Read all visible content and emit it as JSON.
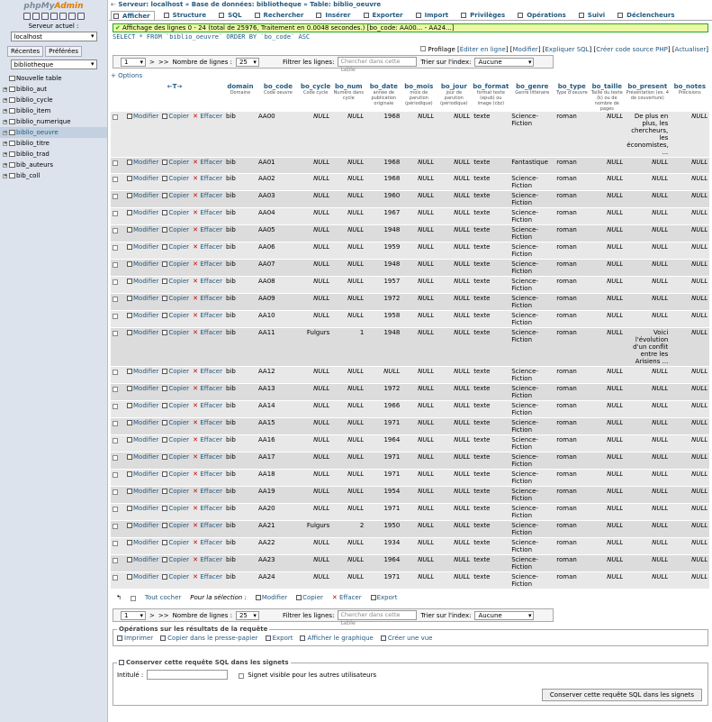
{
  "sidebar": {
    "logo_php": "php",
    "logo_my": "My",
    "logo_admin": "Admin",
    "server_label": "Serveur actuel :",
    "server_value": "localhost",
    "tabs": [
      "Récentes",
      "Préférées"
    ],
    "db_value": "bibliotheque",
    "tree": [
      {
        "label": "Nouvelle table",
        "active": false
      },
      {
        "label": "biblio_aut",
        "active": false
      },
      {
        "label": "biblio_cycle",
        "active": false
      },
      {
        "label": "biblio_item",
        "active": false
      },
      {
        "label": "biblio_numerique",
        "active": false
      },
      {
        "label": "biblio_oeuvre",
        "active": true
      },
      {
        "label": "biblio_titre",
        "active": false
      },
      {
        "label": "biblio_trad",
        "active": false
      },
      {
        "label": "bib_auteurs",
        "active": false
      },
      {
        "label": "bib_coll",
        "active": false
      }
    ]
  },
  "breadcrumb": {
    "server": "Serveur: localhost",
    "db": "Base de données: bibliotheque",
    "table": "Table: biblio_oeuvre"
  },
  "tabs": [
    "Afficher",
    "Structure",
    "SQL",
    "Rechercher",
    "Insérer",
    "Exporter",
    "Import",
    "Privilèges",
    "Opérations",
    "Suivi",
    "Déclencheurs"
  ],
  "message": "Affichage des lignes 0 - 24 (total de 25976, Traitement en 0.0048 secondes.) [bo_code: AA00... - AA24...]",
  "sql": "SELECT * FROM `biblio_oeuvre` ORDER BY `bo_code` ASC",
  "profiling": {
    "label": "Profilage",
    "links": [
      "Éditer en ligne",
      "Modifier",
      "Expliquer SQL",
      "Créer code source PHP",
      "Actualiser"
    ]
  },
  "nav": {
    "page": "1",
    "next": ">",
    "last": ">>",
    "rows_label": "Nombre de lignes :",
    "rows_value": "25",
    "filter_label": "Filtrer les lignes:",
    "filter_placeholder": "Chercher dans cette table",
    "sort_label": "Trier sur l'index:",
    "sort_value": "Aucune"
  },
  "options_link": "+ Options",
  "columns": [
    {
      "name": "domain",
      "sub": "Domaine"
    },
    {
      "name": "bo_code",
      "sub": "Code oeuvre"
    },
    {
      "name": "bo_cycle",
      "sub": "Code cycle"
    },
    {
      "name": "bo_num",
      "sub": "Numéro dans cycle"
    },
    {
      "name": "bo_date",
      "sub": "année de publication originale"
    },
    {
      "name": "bo_mois",
      "sub": "mois de parution (périodique)"
    },
    {
      "name": "bo_jour",
      "sub": "jour de parution (périodique)"
    },
    {
      "name": "bo_format",
      "sub": "format texte (epub) ou image (cbz)"
    },
    {
      "name": "bo_genre",
      "sub": "Genre littéraire"
    },
    {
      "name": "bo_type",
      "sub": "Type d'oeuvre"
    },
    {
      "name": "bo_taille",
      "sub": "Taille du texte (k) ou de nombre de pages"
    },
    {
      "name": "bo_present",
      "sub": "Présentation (ex. 4 de couverture)"
    },
    {
      "name": "bo_notes",
      "sub": "Précisions"
    }
  ],
  "row_actions": {
    "edit": "Modifier",
    "copy": "Copier",
    "delete": "Effacer"
  },
  "rows": [
    [
      "bib",
      "AA00",
      "NULL",
      "NULL",
      "1968",
      "NULL",
      "NULL",
      "texte",
      "Science-Fiction",
      "roman",
      "NULL",
      "De plus en plus, les chercheurs, les économistes, ...",
      "NULL"
    ],
    [
      "bib",
      "AA01",
      "NULL",
      "NULL",
      "1968",
      "NULL",
      "NULL",
      "texte",
      "Fantastique",
      "roman",
      "NULL",
      "NULL",
      "NULL"
    ],
    [
      "bib",
      "AA02",
      "NULL",
      "NULL",
      "1968",
      "NULL",
      "NULL",
      "texte",
      "Science-Fiction",
      "roman",
      "NULL",
      "NULL",
      "NULL"
    ],
    [
      "bib",
      "AA03",
      "NULL",
      "NULL",
      "1960",
      "NULL",
      "NULL",
      "texte",
      "Science-Fiction",
      "roman",
      "NULL",
      "NULL",
      "NULL"
    ],
    [
      "bib",
      "AA04",
      "NULL",
      "NULL",
      "1967",
      "NULL",
      "NULL",
      "texte",
      "Science-Fiction",
      "roman",
      "NULL",
      "NULL",
      "NULL"
    ],
    [
      "bib",
      "AA05",
      "NULL",
      "NULL",
      "1948",
      "NULL",
      "NULL",
      "texte",
      "Science-Fiction",
      "roman",
      "NULL",
      "NULL",
      "NULL"
    ],
    [
      "bib",
      "AA06",
      "NULL",
      "NULL",
      "1959",
      "NULL",
      "NULL",
      "texte",
      "Science-Fiction",
      "roman",
      "NULL",
      "NULL",
      "NULL"
    ],
    [
      "bib",
      "AA07",
      "NULL",
      "NULL",
      "1948",
      "NULL",
      "NULL",
      "texte",
      "Science-Fiction",
      "roman",
      "NULL",
      "NULL",
      "NULL"
    ],
    [
      "bib",
      "AA08",
      "NULL",
      "NULL",
      "1957",
      "NULL",
      "NULL",
      "texte",
      "Science-Fiction",
      "roman",
      "NULL",
      "NULL",
      "NULL"
    ],
    [
      "bib",
      "AA09",
      "NULL",
      "NULL",
      "1972",
      "NULL",
      "NULL",
      "texte",
      "Science-Fiction",
      "roman",
      "NULL",
      "NULL",
      "NULL"
    ],
    [
      "bib",
      "AA10",
      "NULL",
      "NULL",
      "1958",
      "NULL",
      "NULL",
      "texte",
      "Science-Fiction",
      "roman",
      "NULL",
      "NULL",
      "NULL"
    ],
    [
      "bib",
      "AA11",
      "Fulgurs",
      "1",
      "1948",
      "NULL",
      "NULL",
      "texte",
      "Science-Fiction",
      "roman",
      "NULL",
      "Voici l'évolution d'un conflit entre les Arisiens ...",
      "NULL"
    ],
    [
      "bib",
      "AA12",
      "NULL",
      "NULL",
      "NULL",
      "NULL",
      "NULL",
      "texte",
      "Science-Fiction",
      "roman",
      "NULL",
      "NULL",
      "NULL"
    ],
    [
      "bib",
      "AA13",
      "NULL",
      "NULL",
      "1972",
      "NULL",
      "NULL",
      "texte",
      "Science-Fiction",
      "roman",
      "NULL",
      "NULL",
      "NULL"
    ],
    [
      "bib",
      "AA14",
      "NULL",
      "NULL",
      "1966",
      "NULL",
      "NULL",
      "texte",
      "Science-Fiction",
      "roman",
      "NULL",
      "NULL",
      "NULL"
    ],
    [
      "bib",
      "AA15",
      "NULL",
      "NULL",
      "1971",
      "NULL",
      "NULL",
      "texte",
      "Science-Fiction",
      "roman",
      "NULL",
      "NULL",
      "NULL"
    ],
    [
      "bib",
      "AA16",
      "NULL",
      "NULL",
      "1964",
      "NULL",
      "NULL",
      "texte",
      "Science-Fiction",
      "roman",
      "NULL",
      "NULL",
      "NULL"
    ],
    [
      "bib",
      "AA17",
      "NULL",
      "NULL",
      "1971",
      "NULL",
      "NULL",
      "texte",
      "Science-Fiction",
      "roman",
      "NULL",
      "NULL",
      "NULL"
    ],
    [
      "bib",
      "AA18",
      "NULL",
      "NULL",
      "1971",
      "NULL",
      "NULL",
      "texte",
      "Science-Fiction",
      "roman",
      "NULL",
      "NULL",
      "NULL"
    ],
    [
      "bib",
      "AA19",
      "NULL",
      "NULL",
      "1954",
      "NULL",
      "NULL",
      "texte",
      "Science-Fiction",
      "roman",
      "NULL",
      "NULL",
      "NULL"
    ],
    [
      "bib",
      "AA20",
      "NULL",
      "NULL",
      "1971",
      "NULL",
      "NULL",
      "texte",
      "Science-Fiction",
      "roman",
      "NULL",
      "NULL",
      "NULL"
    ],
    [
      "bib",
      "AA21",
      "Fulgurs",
      "2",
      "1950",
      "NULL",
      "NULL",
      "texte",
      "Science-Fiction",
      "roman",
      "NULL",
      "NULL",
      "NULL"
    ],
    [
      "bib",
      "AA22",
      "NULL",
      "NULL",
      "1934",
      "NULL",
      "NULL",
      "texte",
      "Science-Fiction",
      "roman",
      "NULL",
      "NULL",
      "NULL"
    ],
    [
      "bib",
      "AA23",
      "NULL",
      "NULL",
      "1964",
      "NULL",
      "NULL",
      "texte",
      "Science-Fiction",
      "roman",
      "NULL",
      "NULL",
      "NULL"
    ],
    [
      "bib",
      "AA24",
      "NULL",
      "NULL",
      "1971",
      "NULL",
      "NULL",
      "texte",
      "Science-Fiction",
      "roman",
      "NULL",
      "NULL",
      "NULL"
    ]
  ],
  "bulk": {
    "check_all": "Tout cocher",
    "for_selection": "Pour la sélection :",
    "edit": "Modifier",
    "copy": "Copier",
    "delete": "Effacer",
    "export": "Export"
  },
  "query_ops": {
    "legend": "Opérations sur les résultats de la requête",
    "links": [
      "Imprimer",
      "Copier dans le presse-papier",
      "Export",
      "Afficher le graphique",
      "Créer une vue"
    ]
  },
  "bookmark": {
    "legend": "Conserver cette requête SQL dans les signets",
    "title_label": "Intitulé :",
    "shared_label": "Signet visible pour les autres utilisateurs",
    "button": "Conserver cette requête SQL dans les signets"
  }
}
